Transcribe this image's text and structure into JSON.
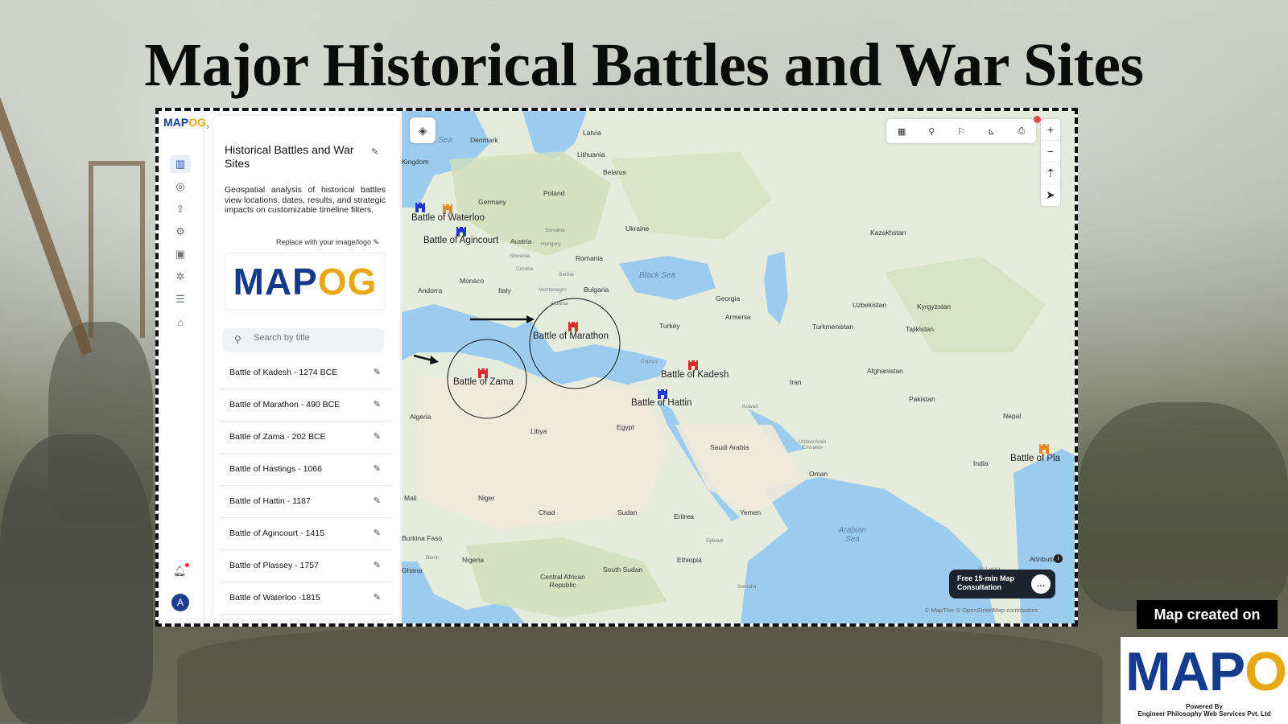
{
  "title": "Major Historical Battles and War Sites",
  "rail": {
    "logo_main": "MAP",
    "logo_accent": "OG",
    "avatar_letter": "A"
  },
  "panel": {
    "title": "Historical Battles and War Sites",
    "description": "Geospatial analysis of historical battles view locations, dates, results, and strategic impacts on customizable timeline filters.",
    "replace_text": "Replace with your image/logo",
    "logo_main": "MAP",
    "logo_accent": "OG",
    "search_placeholder": "Search by title",
    "items": [
      {
        "label": "Battle of Kadesh - 1274 BCE"
      },
      {
        "label": "Battle of Marathon - 490 BCE"
      },
      {
        "label": "Battle of Zama - 202 BCE"
      },
      {
        "label": "Battle of Hastings - 1066"
      },
      {
        "label": "Battle of Hattin - 1187"
      },
      {
        "label": "Battle of Agincourt - 1415"
      },
      {
        "label": "Battle of Plassey - 1757"
      },
      {
        "label": "Battle of Waterloo -1815"
      }
    ]
  },
  "map": {
    "battles": [
      {
        "label": "Battle of Marathon",
        "color": "#d62e2e"
      },
      {
        "label": "Battle of Zama",
        "color": "#d62e2e"
      },
      {
        "label": "Battle of Kadesh",
        "color": "#d62e2e"
      },
      {
        "label": "Battle of Hattin",
        "color": "#2236c9"
      },
      {
        "label": "Battle of Agincourt",
        "color": "#2236c9"
      },
      {
        "label": "Battle of Waterloo",
        "color": "#e88a1e"
      },
      {
        "label": "Battle of Pla",
        "color": "#e88a1e"
      }
    ],
    "countries": [
      "Denmark",
      "Latvia",
      "Lithuania",
      "Belarus",
      "Poland",
      "Germany",
      "Ukraine",
      "Kazakhstan",
      "Austria",
      "Slovakia",
      "Hungary",
      "Slovenia",
      "Croatia",
      "Romania",
      "Serbia",
      "Bulgaria",
      "Montenegro",
      "Albania",
      "Monaco",
      "Italy",
      "Andorra",
      "Turkey",
      "Armenia",
      "Georgia",
      "Uzbekistan",
      "Kyrgyzstan",
      "Turkmenistan",
      "Tajikistan",
      "Afghanistan",
      "Pakistan",
      "Iran",
      "Cyprus",
      "Kuwait",
      "Saudi Arabia",
      "United Arab Emirates",
      "Oman",
      "Yemen",
      "Eritrea",
      "Djibouti",
      "Ethiopia",
      "Somalia",
      "Sudan",
      "Chad",
      "Niger",
      "Mali",
      "Nigeria",
      "Libya",
      "Egypt",
      "Algeria",
      "India",
      "Nepal",
      "Sri Lanka",
      "Burkina Faso",
      "Benin",
      "Ghana",
      "South Sudan",
      "Central African Republic",
      "Kingdom"
    ],
    "seas": [
      "North Sea",
      "Black Sea",
      "Arabian Sea"
    ],
    "attribution": "Attribution",
    "copyright": "© MapTiler © OpenStreetMap contributors",
    "consult": "Free 15-min Map Consultation",
    "zoom_in": "+",
    "zoom_out": "−"
  },
  "badge": {
    "created_on": "Map created on",
    "logo_main": "MAP",
    "logo_accent": "OG",
    "powered_by": "Powered By",
    "company": "Engineer Philosophy Web Services Pvt. Ltd"
  },
  "icons": [
    "map-icon",
    "pin-icon",
    "upload-icon",
    "gear-icon",
    "image-icon",
    "settings-icon",
    "report-icon",
    "user-pin-icon",
    "bell-icon",
    "layers-icon",
    "search-icon",
    "pencil-icon",
    "chat-icon"
  ]
}
